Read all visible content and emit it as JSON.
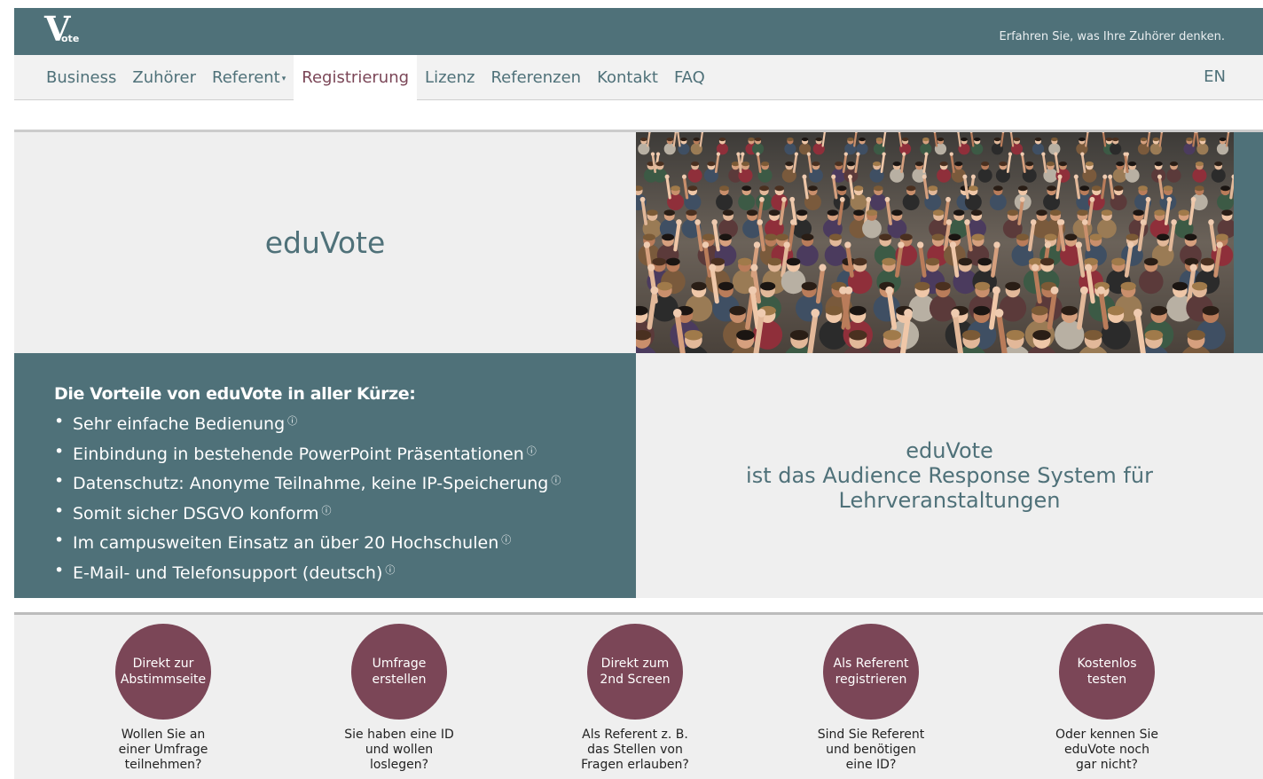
{
  "header": {
    "logo_letter": "V",
    "logo_suffix": "ote",
    "tagline": "Erfahren Sie, was Ihre Zuhörer denken."
  },
  "nav": {
    "items": [
      {
        "label": "Business",
        "active": false
      },
      {
        "label": "Zuhörer",
        "active": false
      },
      {
        "label": "Referent",
        "active": false,
        "dropdown": true,
        "caret": "▾"
      },
      {
        "label": "Registrierung",
        "active": true
      },
      {
        "label": "Lizenz",
        "active": false
      },
      {
        "label": "Referenzen",
        "active": false
      },
      {
        "label": "Kontakt",
        "active": false
      },
      {
        "label": "FAQ",
        "active": false
      }
    ],
    "lang": "EN"
  },
  "hero": {
    "title": "eduVote",
    "photo_subject": "audience-raising-hands-photo"
  },
  "features": {
    "heading": "Die Vorteile von eduVote in aller Kürze:",
    "info_glyph": "ⓘ",
    "items": [
      "Sehr einfache Bedienung",
      "Einbindung in bestehende PowerPoint Präsentationen",
      "Datenschutz: Anonyme Teilnahme, keine IP-Speicherung",
      "Somit sicher DSGVO konform",
      "Im campusweiten Einsatz an über 20 Hochschulen",
      "E-Mail- und Telefonsupport (deutsch)"
    ]
  },
  "claim": {
    "line1": "eduVote",
    "line2": "ist das Audience Response System für",
    "line3": "Lehrveranstaltungen"
  },
  "cta": [
    {
      "button": "Direkt zur Abstimmseite",
      "lines": [
        "Wollen Sie an",
        "einer Umfrage",
        "teilnehmen?"
      ]
    },
    {
      "button": "Umfrage erstellen",
      "lines": [
        "Sie haben eine ID",
        "und wollen",
        "loslegen?"
      ]
    },
    {
      "button": "Direkt zum 2nd Screen",
      "lines": [
        "Als Referent z. B.",
        "das Stellen von",
        "Fragen erlauben?"
      ]
    },
    {
      "button": "Als Referent registrieren",
      "lines": [
        "Sind Sie Referent",
        "und benötigen",
        "eine ID?"
      ]
    },
    {
      "button": "Kostenlos testen",
      "lines": [
        "Oder kennen Sie",
        "eduVote noch",
        "gar nicht?"
      ]
    }
  ],
  "colors": {
    "teal": "#4f7179",
    "plum": "#7b4657",
    "panel": "#efefef"
  }
}
